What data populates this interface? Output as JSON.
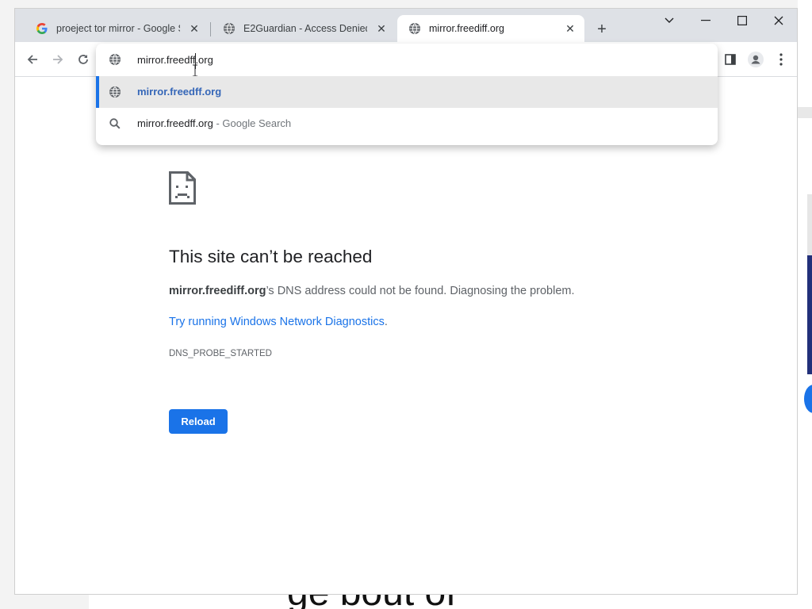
{
  "tabs": [
    {
      "title": "proeject tor mirror - Google Sear",
      "favicon": "google-g-icon",
      "active": false
    },
    {
      "title": "E2Guardian - Access Denied",
      "favicon": "globe-icon",
      "active": false
    },
    {
      "title": "mirror.freediff.org",
      "favicon": "globe-icon",
      "active": true
    }
  ],
  "omnibox": {
    "value": "mirror.freedff.org",
    "suggestions": [
      {
        "text": "mirror.freedff.org",
        "suffix": "",
        "icon": "globe-icon",
        "selected": true
      },
      {
        "text": "mirror.freedff.org",
        "suffix": " - Google Search",
        "icon": "search-icon",
        "selected": false
      }
    ]
  },
  "error_page": {
    "title": "This site can’t be reached",
    "host": "mirror.freediff.org",
    "desc_rest": "’s DNS address could not be found. Diagnosing the problem.",
    "link_text": "Try running Windows Network Diagnostics",
    "link_suffix": ".",
    "code": "DNS_PROBE_STARTED",
    "reload_label": "Reload"
  },
  "colors": {
    "accent": "#1a73e8",
    "tabstrip": "#dee1e6",
    "selected_suggestion": "#3667b8"
  },
  "background_text": "ge            bout         of"
}
